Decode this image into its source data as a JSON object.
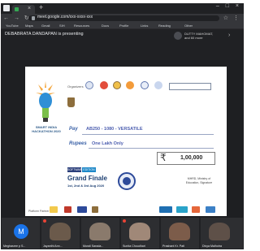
{
  "browser": {
    "window_icon": "app-icon",
    "tab_close": "×",
    "new_tab": "+",
    "window_controls": "– □ ×",
    "nav_glyphs": "← → ↻",
    "url": "meet.google.com/xxx-xxxx-xxx",
    "addr_right_glyphs": "☆ ⋮",
    "bookmarks": [
      "YouTube",
      "Maps",
      "Gmail",
      "SIH",
      "Resources",
      "Docs",
      "Profile",
      "Links",
      "Reading",
      "Other"
    ]
  },
  "meet": {
    "presenter_text": "DEBABRATA DANDAPAN is presenting",
    "user_name": "DUTTY MAHOMAT, and 60 more",
    "header_arrow": "›"
  },
  "slide": {
    "sih_title": "SMART INDIA HACKATHON 2020",
    "organizers_label": "Organizers",
    "pay_label": "Pay",
    "pay_value": "AB250 - 1080 - VERSATILE",
    "rupees_label": "Rupees",
    "rupees_value": "One Lakh Only",
    "rupee_glyph": "₹",
    "amount": "1,00,000",
    "badge_left": "SOFTWARE",
    "badge_right": "EDITION",
    "finale_title": "Grand Finale",
    "finale_dates": "1st, 2nd & 3rd Aug 2020",
    "ministry_text": "MHRD, Ministry of Education, Signature",
    "partners_label": "Platform Partner"
  },
  "participants": [
    {
      "name": "Meghasree p S...",
      "type": "avatar",
      "initial": "M"
    },
    {
      "name": "Jayanthi Ann...",
      "type": "photo"
    },
    {
      "name": "Murali Sarada...",
      "type": "photo"
    },
    {
      "name": "Sunita Choudhari",
      "type": "photo"
    },
    {
      "name": "Prashant Kr. Pati",
      "type": "photo"
    },
    {
      "name": "Divya Malhotra",
      "type": "photo"
    }
  ],
  "colors": {
    "meet_bg": "#202124",
    "slide_accent": "#3d63a8",
    "avatar_blue": "#1a73e8"
  }
}
